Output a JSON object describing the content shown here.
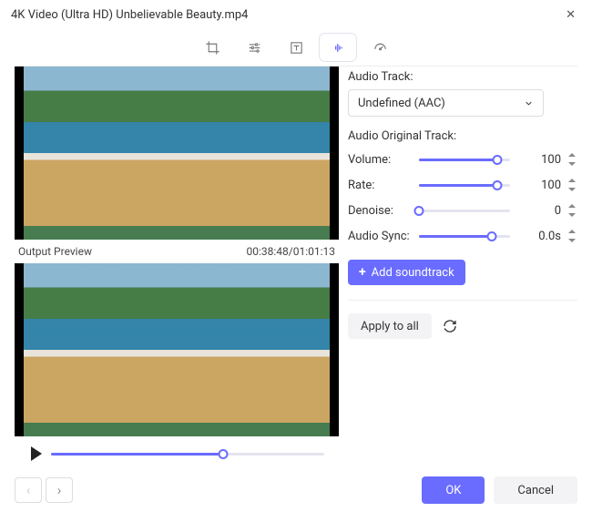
{
  "window": {
    "title": "4K Video (Ultra HD) Unbelievable Beauty.mp4"
  },
  "toolbar": {
    "icons": [
      "crop-icon",
      "adjust-icon",
      "text-icon",
      "audio-icon",
      "speed-icon"
    ],
    "active_index": 3
  },
  "preview": {
    "output_label": "Output Preview",
    "timecode": "00:38:48/01:01:13"
  },
  "audio": {
    "track_label": "Audio Track:",
    "track_selected": "Undefined (AAC)",
    "original_label": "Audio Original Track:",
    "volume_label": "Volume:",
    "volume_value": "100",
    "volume_pct": 86,
    "rate_label": "Rate:",
    "rate_value": "100",
    "rate_pct": 86,
    "denoise_label": "Denoise:",
    "denoise_value": "0",
    "denoise_pct": 0,
    "sync_label": "Audio Sync:",
    "sync_value": "0.0s",
    "sync_pct": 80,
    "add_label": "Add soundtrack",
    "apply_label": "Apply to all"
  },
  "player": {
    "progress_pct": 63
  },
  "footer": {
    "ok": "OK",
    "cancel": "Cancel"
  }
}
